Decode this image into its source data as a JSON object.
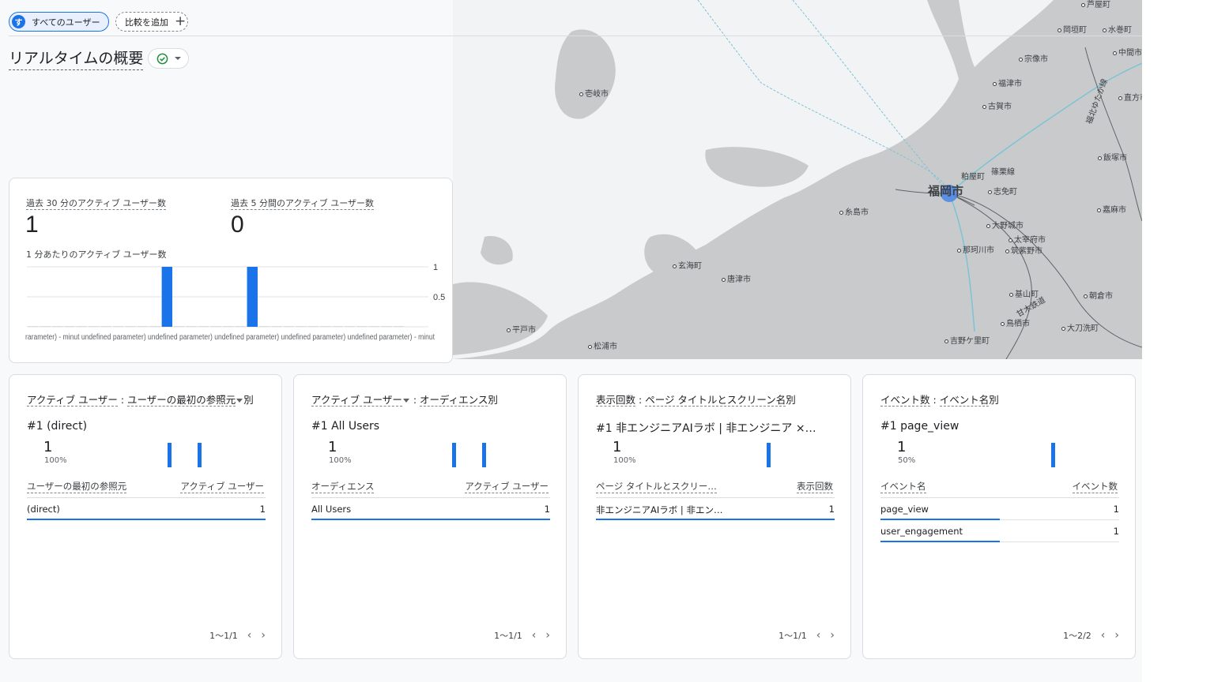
{
  "header": {
    "segment_chip": {
      "avatar": "す",
      "label": "すべてのユーザー"
    },
    "compare_chip": {
      "label": "比較を追加",
      "icon": "plus-icon"
    },
    "page_title": "リアルタイムの概要",
    "status_icon": "check-circle-icon"
  },
  "map": {
    "places": [
      {
        "name": "芦屋町"
      },
      {
        "name": "岡垣町"
      },
      {
        "name": "水巻町"
      },
      {
        "name": "中間市"
      },
      {
        "name": "宗像市"
      },
      {
        "name": "福津市"
      },
      {
        "name": "古賀市"
      },
      {
        "name": "直方市"
      },
      {
        "name": "飯塚市"
      },
      {
        "name": "壱岐市"
      },
      {
        "name": "粕屋町"
      },
      {
        "name": "篠栗線"
      },
      {
        "name": "志免町"
      },
      {
        "name": "福岡市"
      },
      {
        "name": "糸島市"
      },
      {
        "name": "嘉麻市"
      },
      {
        "name": "大野城市"
      },
      {
        "name": "太宰府市"
      },
      {
        "name": "那珂川市"
      },
      {
        "name": "筑紫野市"
      },
      {
        "name": "玄海町"
      },
      {
        "name": "唐津市"
      },
      {
        "name": "基山町"
      },
      {
        "name": "朝倉市"
      },
      {
        "name": "甘木鉄道"
      },
      {
        "name": "平戸市"
      },
      {
        "name": "鳥栖市"
      },
      {
        "name": "大刀洗町"
      },
      {
        "name": "松浦市"
      },
      {
        "name": "吉野ケ里町"
      },
      {
        "name": "福北ゆたか線"
      }
    ],
    "colors": {
      "land": "#c9cacc",
      "sea": "#f1f3f4",
      "rail": "#7cc3d6",
      "highlight": "#4a86e8"
    }
  },
  "realtime": {
    "active_30_label": "過去 30 分のアクティブ ユーザー数",
    "active_30_value": "1",
    "active_5_label": "過去 5 分間のアクティブ ユーザー数",
    "active_5_value": "0",
    "per_minute_label": "1 分あたりのアクティブ ユーザー数"
  },
  "chart_data": {
    "type": "bar",
    "title": "1 分あたりのアクティブ ユーザー数",
    "values": [
      0,
      0,
      0,
      0,
      0,
      0,
      0,
      0,
      0,
      0,
      0,
      1,
      0,
      0,
      0,
      0,
      0,
      0,
      1,
      0,
      0,
      0,
      0,
      0,
      0,
      0,
      0,
      0,
      0,
      0,
      0
    ],
    "ylim": [
      0,
      1
    ],
    "yticks": [
      "0.5",
      "1"
    ],
    "xlabel_text": "rarameter) - minut undefined parameter) undefined parameter) undefined parameter) undefined parameter) undefined parameter) - minut",
    "color": "#1a73e8"
  },
  "cards": [
    {
      "title_parts": [
        "アクティブ ユーザー",
        "ユーザーの最初の参照元",
        "別"
      ],
      "top_name": "#1  (direct)",
      "top_value": "1",
      "top_pct": "100%",
      "col1": "ユーザーの最初の参照元",
      "col2": "アクティブ ユーザー",
      "rows": [
        {
          "name": "(direct)",
          "value": "1",
          "share": 1.0
        }
      ],
      "pager": "1〜1/1"
    },
    {
      "title_parts": [
        "アクティブ ユーザー",
        "オーディエンス",
        "別"
      ],
      "top_name": "#1  All Users",
      "top_value": "1",
      "top_pct": "100%",
      "col1": "オーディエンス",
      "col2": "アクティブ ユーザー",
      "rows": [
        {
          "name": "All Users",
          "value": "1",
          "share": 1.0
        }
      ],
      "pager": "1〜1/1"
    },
    {
      "title_parts": [
        "表示回数",
        "ページ タイトルとスクリーン名",
        "別"
      ],
      "top_name": "#1  非エンジニアAIラボ | 非エンジニア ×…",
      "top_value": "1",
      "top_pct": "100%",
      "col1": "ページ タイトルとスクリー…",
      "col2": "表示回数",
      "rows": [
        {
          "name": "非エンジニアAIラボ | 非エン…",
          "value": "1",
          "share": 1.0
        }
      ],
      "pager": "1〜1/1"
    },
    {
      "title_parts": [
        "イベント数",
        "イベント名",
        "別"
      ],
      "top_name": "#1  page_view",
      "top_value": "1",
      "top_pct": "50%",
      "col1": "イベント名",
      "col2": "イベント数",
      "rows": [
        {
          "name": "page_view",
          "value": "1",
          "share": 0.5
        },
        {
          "name": "user_engagement",
          "value": "1",
          "share": 0.5
        }
      ],
      "pager": "1〜2/2"
    }
  ]
}
